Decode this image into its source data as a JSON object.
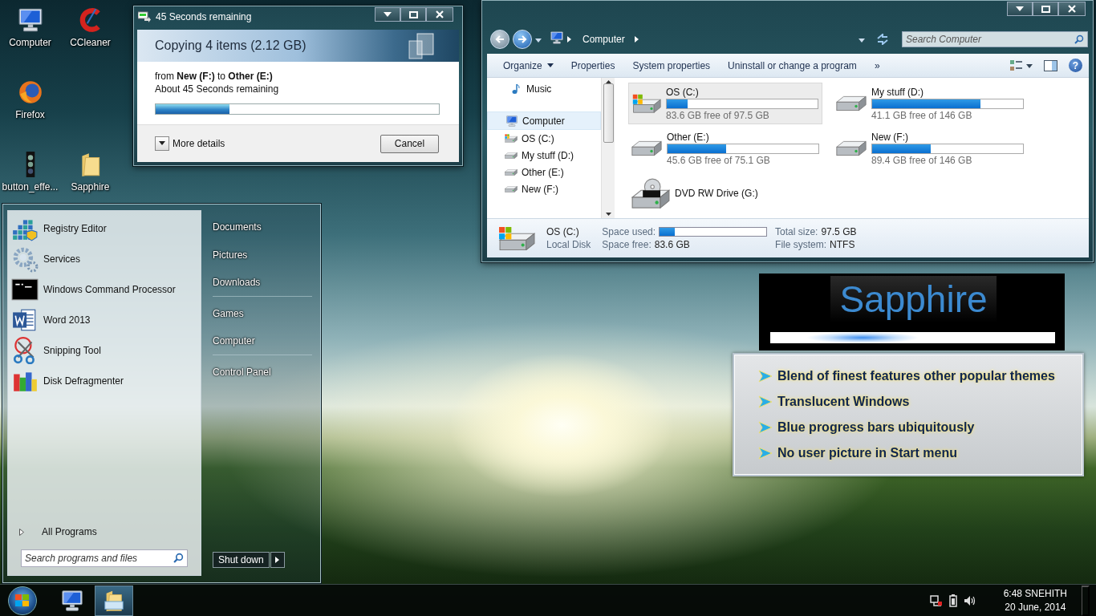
{
  "desktop_icons": [
    {
      "label": "Computer",
      "kind": "computer"
    },
    {
      "label": "CCleaner",
      "kind": "cleaner"
    },
    {
      "label": "Firefox",
      "kind": "browser"
    },
    {
      "label": "button_effe...",
      "kind": "lights"
    },
    {
      "label": "Sapphire",
      "kind": "folder"
    }
  ],
  "copy_dialog": {
    "title": "45 Seconds remaining",
    "heading": "Copying 4 items (2.12 GB)",
    "from_line": "from **New (F:)** to **Other (E:)**",
    "time_line": "About 45 Seconds remaining",
    "progress": {
      "level": 0.26
    },
    "more_details": "More details",
    "cancel": "Cancel"
  },
  "explorer": {
    "breadcrumb": "Computer",
    "search_placeholder": "Search Computer",
    "toolbar": [
      {
        "label": "Organize",
        "dropdown": true
      },
      {
        "label": "Properties",
        "dropdown": false
      },
      {
        "label": "System properties",
        "dropdown": false
      },
      {
        "label": "Uninstall or change a program",
        "dropdown": false
      },
      {
        "label": "»",
        "dropdown": false
      }
    ],
    "help": "?",
    "nav": [
      {
        "label": "Music",
        "kind": "music",
        "selected": false
      },
      {
        "label": "Computer",
        "kind": "computer",
        "selected": true
      },
      {
        "label": "OS (C:)",
        "kind": "os",
        "selected": false
      },
      {
        "label": "My stuff (D:)",
        "kind": "drive",
        "selected": false
      },
      {
        "label": "Other (E:)",
        "kind": "drive",
        "selected": false
      },
      {
        "label": "New (F:)",
        "kind": "drive",
        "selected": false
      }
    ],
    "drives": [
      {
        "name": "OS (C:)",
        "kind": "os",
        "free": "83.6 GB free of 97.5 GB",
        "level": 0.14,
        "selected": true
      },
      {
        "name": "My stuff (D:)",
        "kind": "drive",
        "free": "41.1 GB free of 146 GB",
        "level": 0.72,
        "selected": false
      },
      {
        "name": "Other (E:)",
        "kind": "drive",
        "free": "45.6 GB free of 75.1 GB",
        "level": 0.39,
        "selected": false
      },
      {
        "name": "New (F:)",
        "kind": "drive",
        "free": "89.4 GB free of 146 GB",
        "level": 0.39,
        "selected": false
      },
      {
        "name": "DVD RW Drive (G:)",
        "kind": "dvd",
        "selected": false
      }
    ],
    "details": {
      "name": "OS (C:)",
      "type": "Local Disk",
      "used_label": "Space used:",
      "level": 0.14,
      "free_label": "Space free:",
      "free_value": "83.6 GB",
      "total_label": "Total size:",
      "total_value": "97.5 GB",
      "fs_label": "File system:",
      "fs_value": "NTFS"
    }
  },
  "banner": {
    "title": "Sapphire"
  },
  "features": [
    "Blend of finest features other popular themes",
    "Translucent Windows",
    "Blue progress bars ubiquitously",
    "No user picture in Start menu"
  ],
  "start_menu": {
    "programs": [
      {
        "label": "Registry Editor",
        "kind": "registry"
      },
      {
        "label": "Services",
        "kind": "gear"
      },
      {
        "label": "Windows Command Processor",
        "kind": "console"
      },
      {
        "label": "Word 2013",
        "kind": "word"
      },
      {
        "label": "Snipping Tool",
        "kind": "scissors"
      },
      {
        "label": "Disk Defragmenter",
        "kind": "defrag"
      }
    ],
    "all_programs": "All Programs",
    "search_placeholder": "Search programs and files",
    "places": [
      {
        "label": "Documents",
        "separator_after": false
      },
      {
        "label": "Pictures",
        "separator_after": false
      },
      {
        "label": "Downloads",
        "separator_after": true
      },
      {
        "label": "Games",
        "separator_after": false
      },
      {
        "label": "Computer",
        "separator_after": true
      },
      {
        "label": "Control Panel",
        "separator_after": false
      }
    ],
    "shutdown": "Shut down"
  },
  "taskbar": {
    "pinned": [
      {
        "kind": "computer",
        "active": false
      },
      {
        "kind": "explorer",
        "active": true
      }
    ],
    "time": "6:48 SNEHITH",
    "date": "20 June, 2014"
  }
}
